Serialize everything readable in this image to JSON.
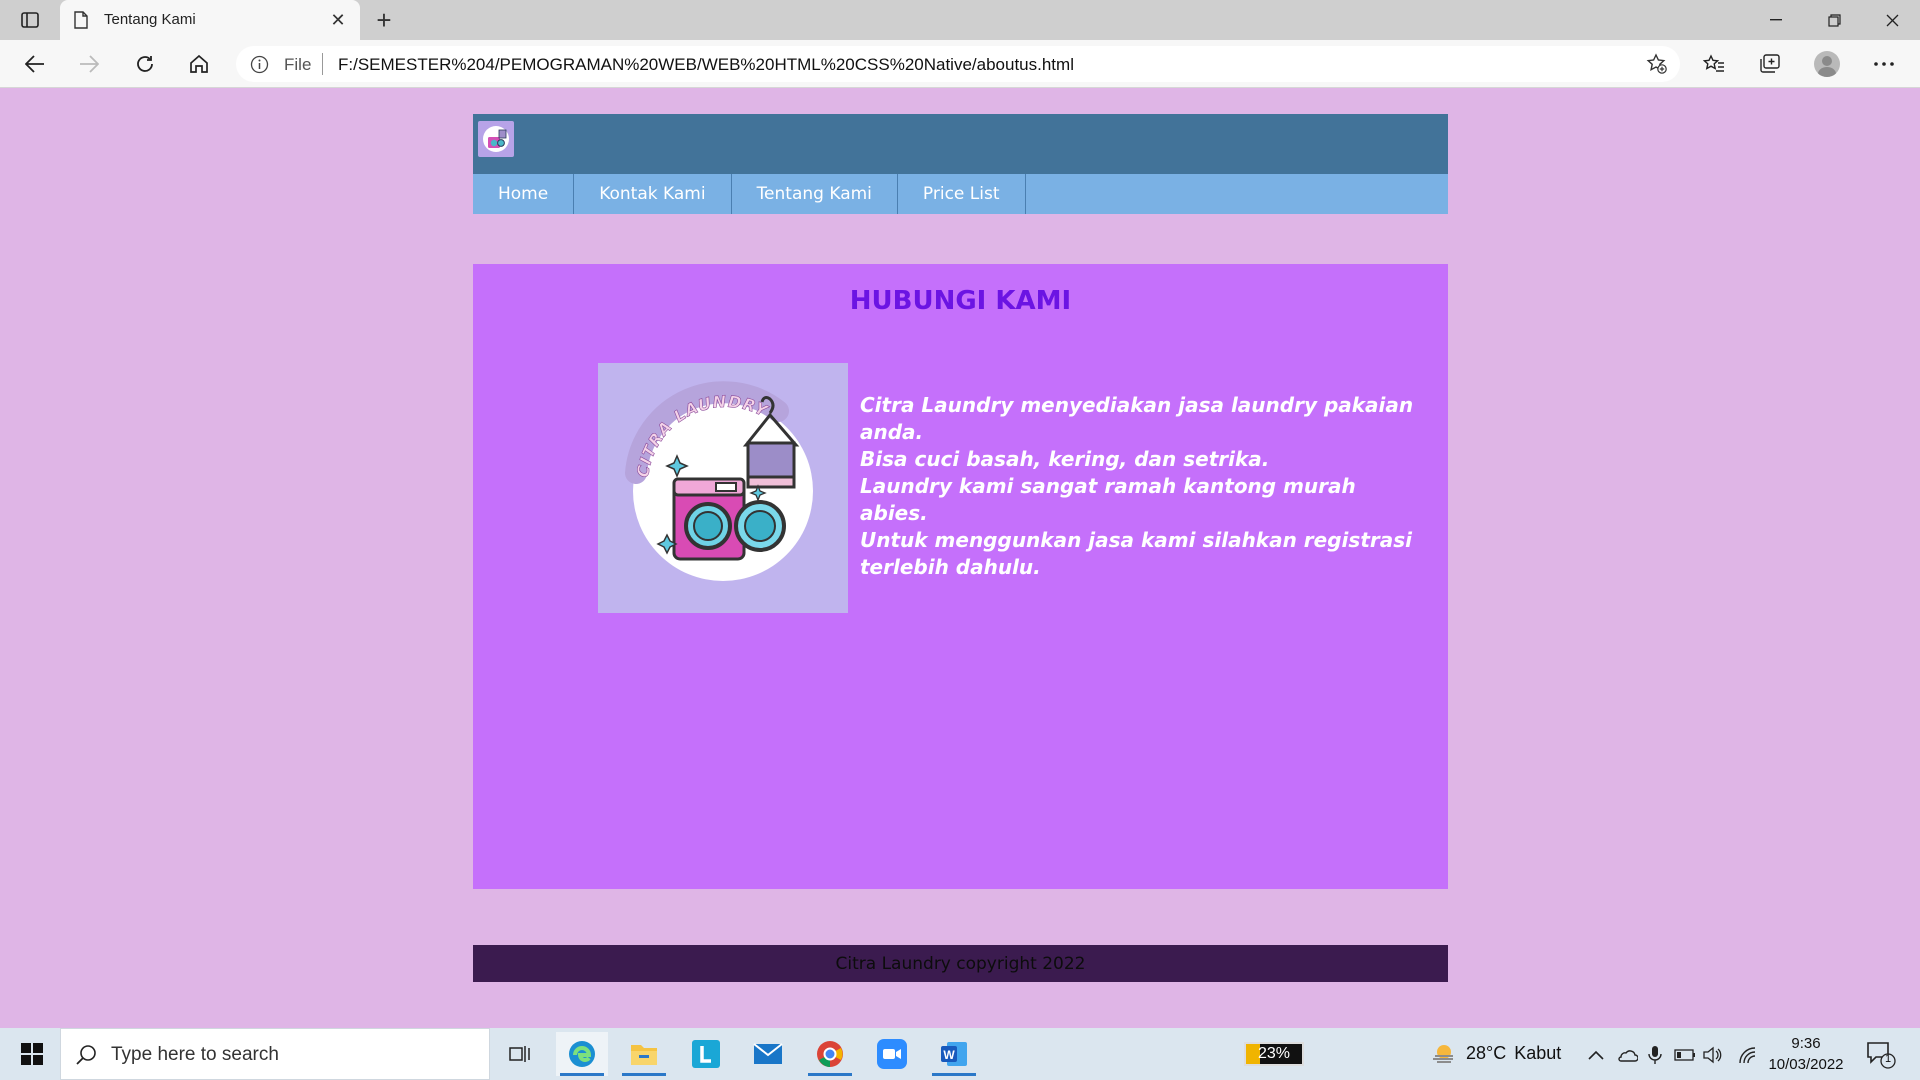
{
  "browser": {
    "tab_title": "Tentang Kami",
    "address_file_label": "File",
    "address_url": "F:/SEMESTER%204/PEMOGRAMAN%20WEB/WEB%20HTML%20CSS%20Native/aboutus.html"
  },
  "site": {
    "nav": [
      "Home",
      "Kontak Kami",
      "Tentang Kami",
      "Price List"
    ],
    "heading": "HUBUNGI KAMI",
    "logo_text": "CITRA LAUNDRY",
    "about_lines": [
      "Citra Laundry menyediakan jasa laundry pakaian anda.",
      "Bisa cuci basah, kering, dan setrika.",
      "Laundry kami sangat ramah kantong murah abies.",
      "Untuk menggunkan jasa kami silahkan registrasi terlebih dahulu."
    ],
    "footer": "Citra Laundry copyright 2022",
    "colors": {
      "background": "#dfb5e6",
      "header": "#427399",
      "nav": "#7ab1e4",
      "content": "#c570fb",
      "heading": "#6b14e3",
      "footer": "#3b1b4f"
    }
  },
  "taskbar": {
    "search_placeholder": "Type here to search",
    "battery_percent": "23%",
    "weather_temp": "28°C",
    "weather_desc": "Kabut",
    "time": "9:36",
    "date": "10/03/2022",
    "notification_count": "1",
    "apps": [
      "task-view-icon",
      "edge-icon",
      "file-explorer-icon",
      "l-app-icon",
      "mail-icon",
      "chrome-icon",
      "zoom-icon",
      "word-icon"
    ]
  }
}
